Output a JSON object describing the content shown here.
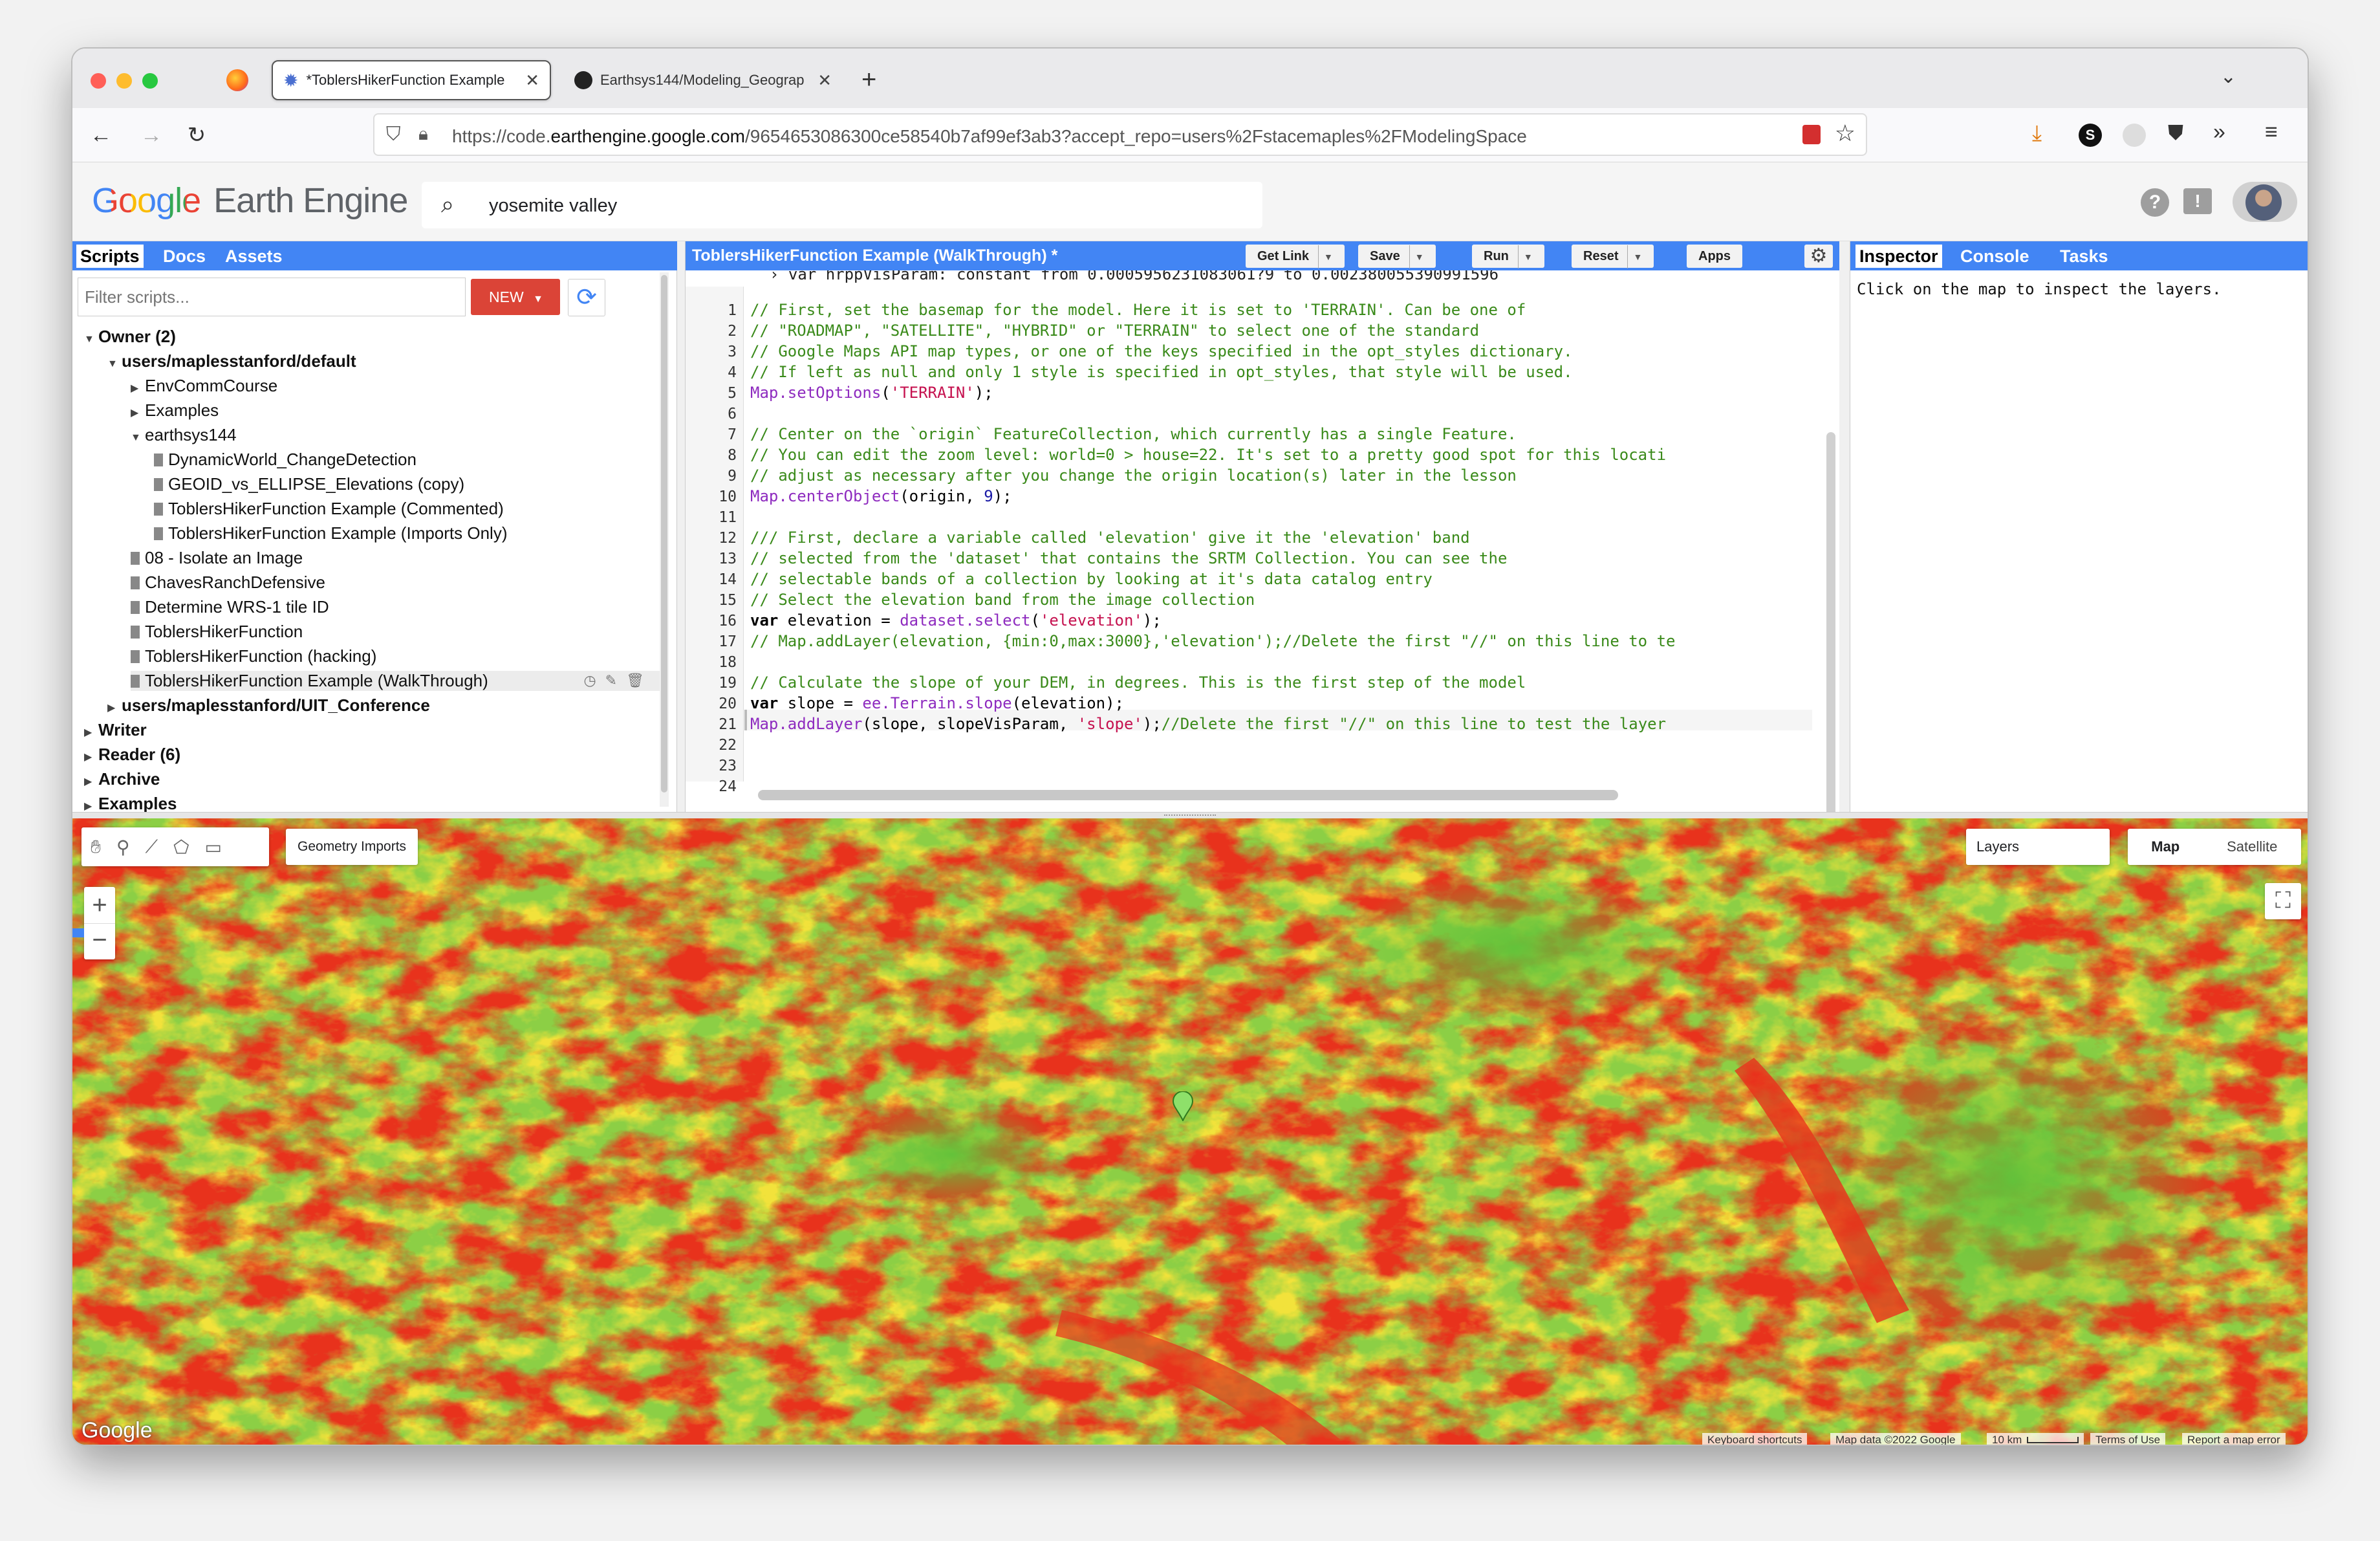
{
  "browser": {
    "tabs": [
      {
        "label": "*ToblersHikerFunction Example",
        "active": true
      },
      {
        "label": "Earthsys144/Modeling_Geograp",
        "active": false
      }
    ],
    "url_prefix": "https://code.",
    "url_domain": "earthengine.google.com",
    "url_rest": "/9654653086300ce58540b7af99ef3ab3?accept_repo=users%2Fstacemaples%2FModelingSpace"
  },
  "ee": {
    "logo_google": "Google",
    "logo_product": "Earth Engine",
    "search_value": "yosemite valley"
  },
  "left_panel": {
    "tabs": [
      "Scripts",
      "Docs",
      "Assets"
    ],
    "filter_placeholder": "Filter scripts...",
    "new_label": "NEW",
    "tree": [
      {
        "label": "Owner (2)",
        "indent": 0,
        "bold": true,
        "kind": "open"
      },
      {
        "label": "users/maplesstanford/default",
        "indent": 1,
        "bold": true,
        "kind": "open"
      },
      {
        "label": "EnvCommCourse",
        "indent": 2,
        "bold": false,
        "kind": "closed"
      },
      {
        "label": "Examples",
        "indent": 2,
        "bold": false,
        "kind": "closed"
      },
      {
        "label": "earthsys144",
        "indent": 2,
        "bold": false,
        "kind": "open"
      },
      {
        "label": "DynamicWorld_ChangeDetection",
        "indent": 3,
        "bold": false,
        "kind": "file"
      },
      {
        "label": "GEOID_vs_ELLIPSE_Elevations (copy)",
        "indent": 3,
        "bold": false,
        "kind": "file"
      },
      {
        "label": "ToblersHikerFunction Example (Commented)",
        "indent": 3,
        "bold": false,
        "kind": "file"
      },
      {
        "label": "ToblersHikerFunction Example (Imports Only)",
        "indent": 3,
        "bold": false,
        "kind": "file"
      },
      {
        "label": "08 - Isolate an Image",
        "indent": 2,
        "bold": false,
        "kind": "file"
      },
      {
        "label": "ChavesRanchDefensive",
        "indent": 2,
        "bold": false,
        "kind": "file"
      },
      {
        "label": "Determine WRS-1 tile ID",
        "indent": 2,
        "bold": false,
        "kind": "file"
      },
      {
        "label": "ToblersHikerFunction",
        "indent": 2,
        "bold": false,
        "kind": "file"
      },
      {
        "label": "ToblersHikerFunction (hacking)",
        "indent": 2,
        "bold": false,
        "kind": "file"
      },
      {
        "label": "ToblersHikerFunction Example (WalkThrough)",
        "indent": 2,
        "bold": false,
        "kind": "file",
        "selected": true
      },
      {
        "label": "users/maplesstanford/UIT_Conference",
        "indent": 1,
        "bold": true,
        "kind": "closed"
      },
      {
        "label": "Writer",
        "indent": 0,
        "bold": true,
        "kind": "closed"
      },
      {
        "label": "Reader (6)",
        "indent": 0,
        "bold": true,
        "kind": "closed"
      },
      {
        "label": "Archive",
        "indent": 0,
        "bold": true,
        "kind": "closed"
      },
      {
        "label": "Examples",
        "indent": 0,
        "bold": true,
        "kind": "closed"
      }
    ]
  },
  "editor": {
    "title": "ToblersHikerFunction Example (WalkThrough) *",
    "buttons": [
      "Get Link",
      "Save",
      "Run",
      "Reset",
      "Apps"
    ],
    "import_line": "› var hrppVisParam: constant from 0.0005956231083061?9 to 0.002380055390991596",
    "lines": [
      {
        "n": 1,
        "html": "<span class='com'>// First, set the basemap for the model. Here it is set to 'TERRAIN'. Can be one of</span>"
      },
      {
        "n": 2,
        "html": "<span class='com'>// \"ROADMAP\", \"SATELLITE\", \"HYBRID\" or \"TERRAIN\" to select one of the standard</span>"
      },
      {
        "n": 3,
        "html": "<span class='com'>// Google Maps API map types, or one of the keys specified in the opt_styles dictionary.</span>"
      },
      {
        "n": 4,
        "html": "<span class='com'>// If left as null and only 1 style is specified in opt_styles, that style will be used.</span>"
      },
      {
        "n": 5,
        "html": "<span class='fn'>Map.setOptions</span>(<span class='str'>'TERRAIN'</span>);"
      },
      {
        "n": 6,
        "html": ""
      },
      {
        "n": 7,
        "html": "<span class='com'>// Center on the `origin` FeatureCollection, which currently has a single Feature.</span>"
      },
      {
        "n": 8,
        "html": "<span class='com'>// You can edit the zoom level: world=0 &gt; house=22. It's set to a pretty good spot for this locati</span>"
      },
      {
        "n": 9,
        "html": "<span class='com'>// adjust as necessary after you change the origin location(s) later in the lesson</span>"
      },
      {
        "n": 10,
        "html": "<span class='fn'>Map.centerObject</span>(origin, <span class='num'>9</span>);"
      },
      {
        "n": 11,
        "html": ""
      },
      {
        "n": 12,
        "html": "<span class='com'>/// First, declare a variable called 'elevation' give it the 'elevation' band</span>"
      },
      {
        "n": 13,
        "html": "<span class='com'>// selected from the 'dataset' that contains the SRTM Collection. You can see the</span>"
      },
      {
        "n": 14,
        "html": "<span class='com'>// selectable bands of a collection by looking at it's data catalog entry</span>"
      },
      {
        "n": 15,
        "html": "<span class='com'>// Select the elevation band from the image collection</span>"
      },
      {
        "n": 16,
        "html": "<span class='kw'>var</span> elevation = <span class='fn'>dataset.select</span>(<span class='str'>'elevation'</span>);"
      },
      {
        "n": 17,
        "html": "<span class='com'>// Map.addLayer(elevation, {min:0,max:3000},'elevation');//Delete the first \"//\" on this line to te</span>"
      },
      {
        "n": 18,
        "html": ""
      },
      {
        "n": 19,
        "html": "<span class='com'>// Calculate the slope of your DEM, in degrees. This is the first step of the model</span>"
      },
      {
        "n": 20,
        "html": "<span class='kw'>var</span> slope = <span class='fn'>ee.Terrain.slope</span>(elevation);"
      },
      {
        "n": 21,
        "html": "<span class='fn'>Map.addLayer</span>(slope, slopeVisParam, <span class='str'>'slope'</span>);<span class='com'>//Delete the first \"//\" on this line to test the layer</span>"
      },
      {
        "n": 22,
        "html": ""
      },
      {
        "n": 23,
        "html": ""
      },
      {
        "n": 24,
        "html": ""
      }
    ]
  },
  "right_panel": {
    "tabs": [
      "Inspector",
      "Console",
      "Tasks"
    ],
    "message": "Click on the map to inspect the layers."
  },
  "map": {
    "geometry_imports": "Geometry Imports",
    "layers_label": "Layers",
    "map_label": "Map",
    "satellite_label": "Satellite",
    "zoom_in": "+",
    "zoom_out": "−",
    "google_logo": "Google",
    "footer": [
      "Keyboard shortcuts",
      "Map data ©2022 Google",
      "10 km",
      "Terms of Use",
      "Report a map error"
    ]
  },
  "colors": {
    "accent": "#4285f4",
    "new_btn": "#db4437",
    "slope_low": "#7ccf3a",
    "slope_mid": "#f0e040",
    "slope_high": "#e83a1e"
  }
}
